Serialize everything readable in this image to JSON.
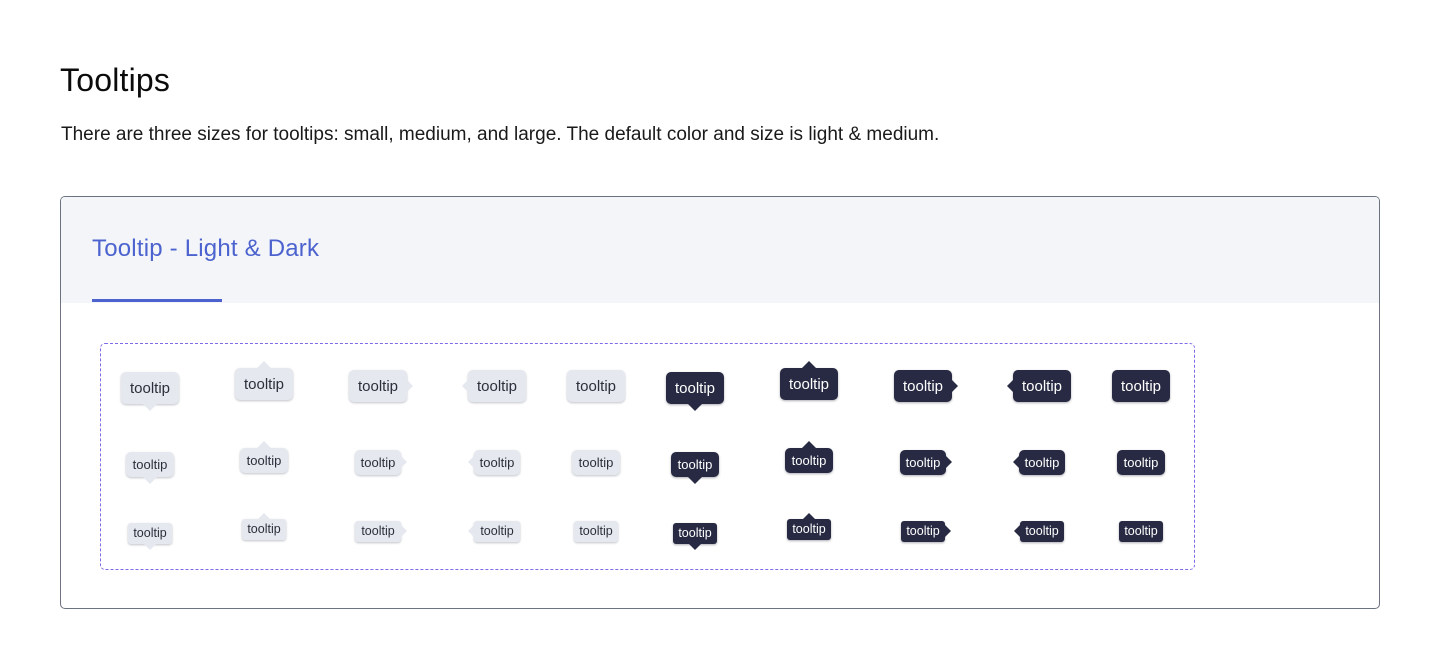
{
  "page": {
    "title": "Tooltips",
    "description": "There are three sizes for tooltips: small, medium, and large. The default color and size is light & medium."
  },
  "card": {
    "tab_label": "Tooltip - Light & Dark"
  },
  "tooltip_label": "tooltip",
  "rows": [
    {
      "size": "large",
      "tooltips": [
        {
          "label": "tooltip",
          "theme": "light",
          "arrow": "bottom"
        },
        {
          "label": "tooltip",
          "theme": "light",
          "arrow": "top"
        },
        {
          "label": "tooltip",
          "theme": "light",
          "arrow": "right"
        },
        {
          "label": "tooltip",
          "theme": "light",
          "arrow": "left"
        },
        {
          "label": "tooltip",
          "theme": "light",
          "arrow": "none"
        },
        {
          "label": "tooltip",
          "theme": "dark",
          "arrow": "bottom"
        },
        {
          "label": "tooltip",
          "theme": "dark",
          "arrow": "top"
        },
        {
          "label": "tooltip",
          "theme": "dark",
          "arrow": "right"
        },
        {
          "label": "tooltip",
          "theme": "dark",
          "arrow": "left"
        },
        {
          "label": "tooltip",
          "theme": "dark",
          "arrow": "none"
        }
      ]
    },
    {
      "size": "medium",
      "tooltips": [
        {
          "label": "tooltip",
          "theme": "light",
          "arrow": "bottom"
        },
        {
          "label": "tooltip",
          "theme": "light",
          "arrow": "top"
        },
        {
          "label": "tooltip",
          "theme": "light",
          "arrow": "right"
        },
        {
          "label": "tooltip",
          "theme": "light",
          "arrow": "left"
        },
        {
          "label": "tooltip",
          "theme": "light",
          "arrow": "none"
        },
        {
          "label": "tooltip",
          "theme": "dark",
          "arrow": "bottom"
        },
        {
          "label": "tooltip",
          "theme": "dark",
          "arrow": "top"
        },
        {
          "label": "tooltip",
          "theme": "dark",
          "arrow": "right"
        },
        {
          "label": "tooltip",
          "theme": "dark",
          "arrow": "left"
        },
        {
          "label": "tooltip",
          "theme": "dark",
          "arrow": "none"
        }
      ]
    },
    {
      "size": "small",
      "tooltips": [
        {
          "label": "tooltip",
          "theme": "light",
          "arrow": "bottom"
        },
        {
          "label": "tooltip",
          "theme": "light",
          "arrow": "top"
        },
        {
          "label": "tooltip",
          "theme": "light",
          "arrow": "right"
        },
        {
          "label": "tooltip",
          "theme": "light",
          "arrow": "left"
        },
        {
          "label": "tooltip",
          "theme": "light",
          "arrow": "none"
        },
        {
          "label": "tooltip",
          "theme": "dark",
          "arrow": "bottom"
        },
        {
          "label": "tooltip",
          "theme": "dark",
          "arrow": "top"
        },
        {
          "label": "tooltip",
          "theme": "dark",
          "arrow": "right"
        },
        {
          "label": "tooltip",
          "theme": "dark",
          "arrow": "left"
        },
        {
          "label": "tooltip",
          "theme": "dark",
          "arrow": "none"
        }
      ]
    }
  ],
  "colors": {
    "accent": "#4c63cf",
    "light_tooltip_bg": "#e5e8ef",
    "dark_tooltip_bg": "#272a42",
    "demo_border": "#7d6ae6",
    "header_bg": "#f3f5f9"
  }
}
